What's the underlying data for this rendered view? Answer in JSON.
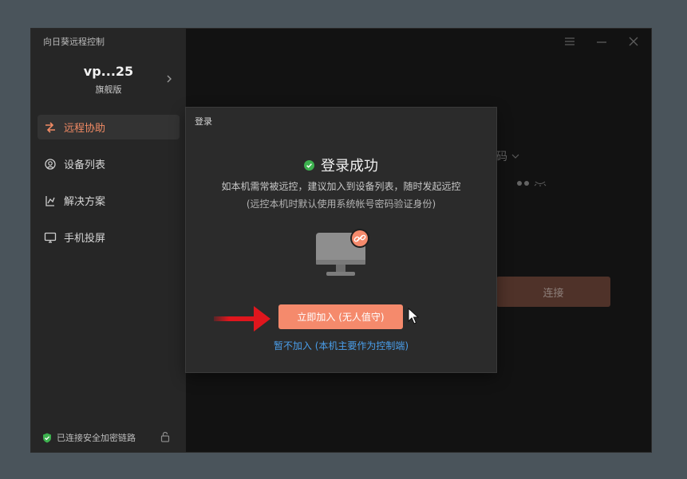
{
  "app": {
    "title": "向日葵远程控制"
  },
  "account": {
    "name": "vp...25",
    "edition": "旗舰版"
  },
  "nav": [
    {
      "label": "远程协助",
      "icon": "remote-assist-icon",
      "active": true
    },
    {
      "label": "设备列表",
      "icon": "device-list-icon",
      "active": false
    },
    {
      "label": "解决方案",
      "icon": "solution-icon",
      "active": false
    },
    {
      "label": "手机投屏",
      "icon": "screen-cast-icon",
      "active": false
    }
  ],
  "status": {
    "secure_link": "已连接安全加密链路"
  },
  "background": {
    "login_hint": "码",
    "connect_label": "连接"
  },
  "dialog": {
    "title": "登录",
    "heading": "登录成功",
    "line1": "如本机需常被远控，建议加入到设备列表，随时发起远控",
    "line2": "(远控本机时默认使用系统帐号密码验证身份)",
    "primary_label": "立即加入 (无人值守)",
    "secondary_label": "暂不加入 (本机主要作为控制端)"
  },
  "colors": {
    "accent": "#f58a6c",
    "active_nav": "#f08a64",
    "link": "#4a9eea",
    "success": "#3db24f",
    "annotation_arrow": "#e0161d"
  }
}
